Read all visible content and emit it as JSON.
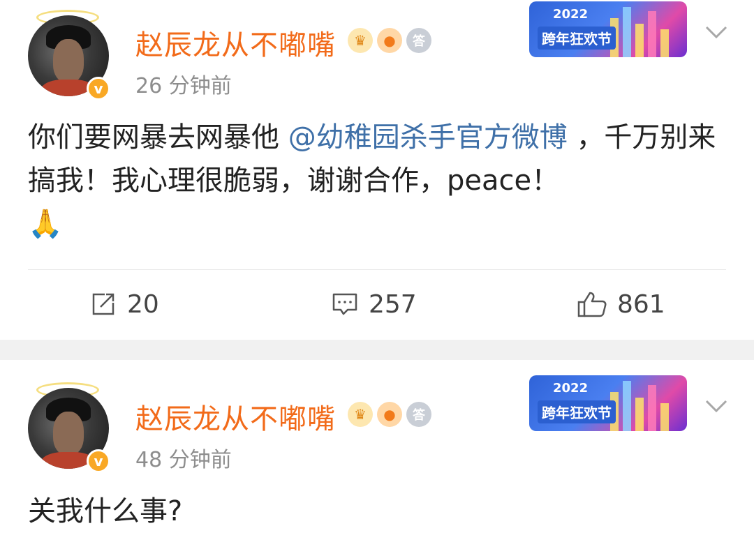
{
  "posts": [
    {
      "username": "赵辰龙从不嘟嘴",
      "timestamp": "26 分钟前",
      "event_banner": {
        "year": "2022",
        "title": "跨年狂欢节"
      },
      "content_prefix": "你们要网暴去网暴他",
      "mention": "@幼稚园杀手官方微博",
      "content_suffix": "，千万别来搞我！我心理很脆弱，谢谢合作，peace！",
      "content_emoji": "🙏",
      "actions": {
        "repost_count": "20",
        "comment_count": "257",
        "like_count": "861"
      }
    },
    {
      "username": "赵辰龙从不嘟嘴",
      "timestamp": "48 分钟前",
      "event_banner": {
        "year": "2022",
        "title": "跨年狂欢节"
      },
      "content": "关我什么事?"
    }
  ],
  "badges": {
    "crown_icon": "crown-icon",
    "fish_icon": "fish-icon",
    "answer_label": "答"
  },
  "colors": {
    "username": "#f26b1a",
    "mention": "#3f70a8",
    "timestamp": "#8d8d8d",
    "separator": "#f1f1f1",
    "verified": "#f9a825"
  }
}
